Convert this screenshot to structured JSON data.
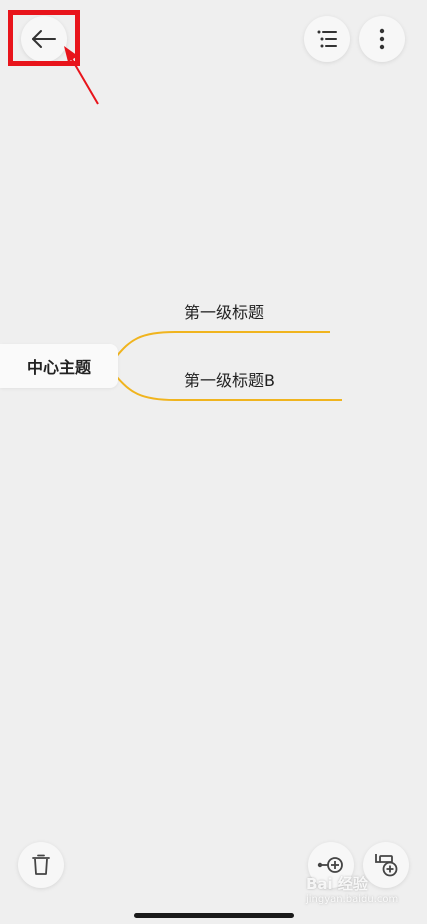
{
  "toolbar": {
    "back_icon": "arrow-left-icon",
    "outline_icon": "outline-list-icon",
    "more_icon": "more-vertical-icon"
  },
  "mindmap": {
    "central_topic": "中心主题",
    "branches": [
      {
        "label": "第一级标题"
      },
      {
        "label": "第一级标题B"
      }
    ],
    "branch_color": "#f0b41e"
  },
  "bottom_bar": {
    "delete_icon": "trash-icon",
    "add_sibling_icon": "add-sibling-node-icon",
    "add_child_icon": "add-child-node-icon"
  },
  "annotation": {
    "highlight_color": "#e8141b"
  },
  "watermark": {
    "text": "Bai 经验",
    "subtext": "jingyan.baidu.com"
  }
}
